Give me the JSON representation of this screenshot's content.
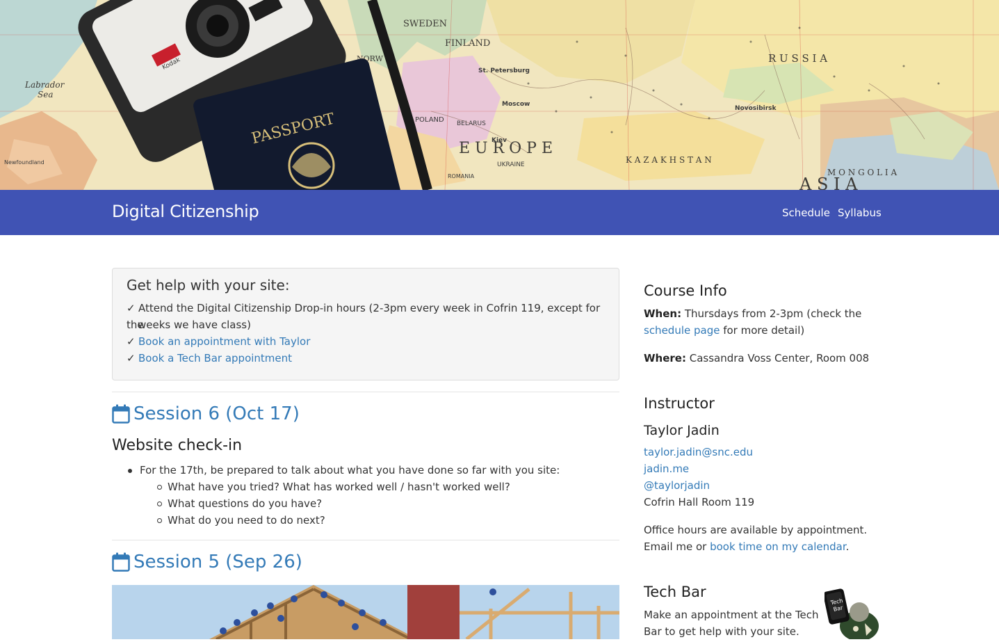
{
  "hero": {
    "map_labels": {
      "sweden": "SWEDEN",
      "finland": "FINLAND",
      "russia": "R U S S I A",
      "europe": "E U R O P E",
      "kazakhstan": "K A Z A K H S T A N",
      "mongolia": "M O N G O L I A",
      "asia": "A S I A",
      "labrador": "Labrador",
      "sea": "Sea",
      "newfoundland": "Newfoundland",
      "moscow": "Moscow",
      "kiev": "Kiev",
      "ukraine": "UKRAINE",
      "belarus": "BELARUS",
      "poland": "POLAND",
      "romania": "ROMANIA",
      "stpetersburg": "St. Petersburg",
      "novosibirsk": "Novosibirsk",
      "norw": "NORW",
      "passport": "PASSPORT",
      "camera_brand": "Kodak"
    }
  },
  "navbar": {
    "brand": "Digital Citizenship",
    "links": [
      "Schedule",
      "Syllabus"
    ]
  },
  "help": {
    "title": "Get help with your site:",
    "check": "✓",
    "item1_line1": "Attend the Digital Citizenship Drop-in hours (2-3pm every week in Cofrin 119, except for the",
    "item1_line2": "weeks we have class)",
    "item2": "Book an appointment with Taylor",
    "item3": "Book a Tech Bar appointment"
  },
  "sessions": [
    {
      "title": "Session 6 (Oct 17)",
      "subtitle": "Website check-in",
      "bullet": "For the 17th, be prepared to talk about what you have done so far with you site:",
      "subbullets": [
        "What have you tried? What has worked well / hasn't worked well?",
        "What questions do you have?",
        "What do you need to do next?"
      ]
    },
    {
      "title": "Session 5 (Sep 26)"
    }
  ],
  "sidebar": {
    "course_info": {
      "heading": "Course Info",
      "when_label": "When:",
      "when_text": " Thursdays from 2-3pm (check the",
      "schedule_link": "schedule page",
      "when_tail": " for more detail)",
      "where_label": "Where:",
      "where_text": " Cassandra Voss Center, Room 008"
    },
    "instructor": {
      "heading": "Instructor",
      "name": "Taylor Jadin",
      "email": "taylor.jadin@snc.edu",
      "website": "jadin.me",
      "twitter": "@taylorjadin",
      "office": "Cofrin Hall Room 119",
      "office_hours": "Office hours are available by appointment.",
      "email_me": "Email me or ",
      "calendar_link": "book time on my calendar",
      "period": "."
    },
    "techbar": {
      "heading": "Tech Bar",
      "line1": "Make an appointment at the Tech",
      "line2": "Bar to get help with your site.",
      "logo_text_1": "Tech",
      "logo_text_2": "Bar"
    }
  },
  "colors": {
    "navbar": "#4053b4",
    "link": "#337ab7",
    "helpbox_bg": "#f5f5f5"
  }
}
